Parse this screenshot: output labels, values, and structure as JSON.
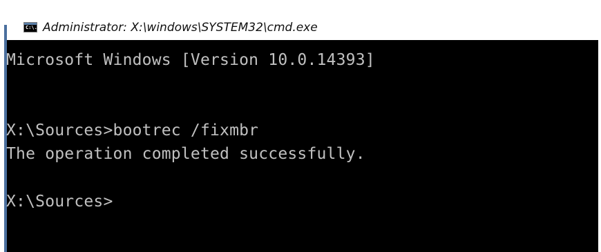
{
  "window": {
    "title": "Administrator: X:\\windows\\SYSTEM32\\cmd.exe",
    "icon": "cmd-icon",
    "icon_text": "C:\\."
  },
  "console": {
    "lines": [
      "Microsoft Windows [Version 10.0.14393]",
      "X:\\Sources>bootrec /fixmbr",
      "The operation completed successfully.",
      "X:\\Sources>"
    ],
    "background_color": "#000000",
    "text_color": "#c0c0c0"
  }
}
